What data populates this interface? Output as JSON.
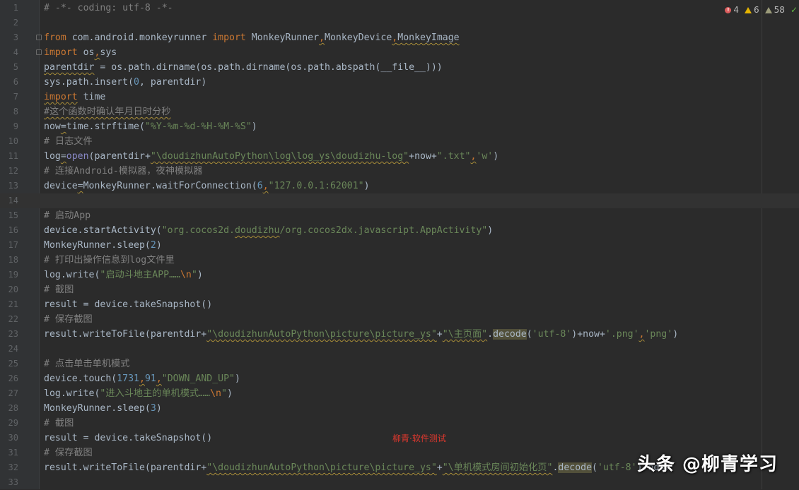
{
  "editor": {
    "current_line": 14,
    "lines": [
      {
        "n": "1",
        "fold": false,
        "tokens": [
          {
            "t": "# -*- coding: utf-8 -*-",
            "c": "comment"
          }
        ]
      },
      {
        "n": "2",
        "fold": false,
        "tokens": []
      },
      {
        "n": "3",
        "fold": true,
        "tokens": [
          {
            "t": "from",
            "c": "keyword"
          },
          {
            "t": " com.android.monkeyrunner ",
            "c": "default"
          },
          {
            "t": "import",
            "c": "keyword"
          },
          {
            "t": " MonkeyRunner",
            "c": "default"
          },
          {
            "t": ",",
            "c": "keyword",
            "w": true
          },
          {
            "t": "MonkeyDevice",
            "c": "default"
          },
          {
            "t": ",",
            "c": "keyword",
            "w": true
          },
          {
            "t": "MonkeyImage",
            "c": "default",
            "w": true
          }
        ]
      },
      {
        "n": "4",
        "fold": true,
        "tokens": [
          {
            "t": "import",
            "c": "keyword"
          },
          {
            "t": " os",
            "c": "default"
          },
          {
            "t": ",",
            "c": "keyword",
            "w": true
          },
          {
            "t": "sys",
            "c": "default"
          }
        ]
      },
      {
        "n": "5",
        "fold": false,
        "tokens": [
          {
            "t": "parentdir",
            "c": "default",
            "w": true
          },
          {
            "t": " = os.path.dirname(os.path.dirname(os.path.abspath(__file__)))",
            "c": "default"
          }
        ]
      },
      {
        "n": "6",
        "fold": false,
        "tokens": [
          {
            "t": "sys.path.insert(",
            "c": "default"
          },
          {
            "t": "0",
            "c": "number"
          },
          {
            "t": ", parentdir)",
            "c": "default"
          }
        ]
      },
      {
        "n": "7",
        "fold": false,
        "tokens": [
          {
            "t": "import",
            "c": "keyword",
            "w": true
          },
          {
            "t": " time",
            "c": "default"
          }
        ]
      },
      {
        "n": "8",
        "fold": false,
        "tokens": [
          {
            "t": "#这个函数时确认年月日时分秒",
            "c": "comment",
            "w": true
          }
        ]
      },
      {
        "n": "9",
        "fold": false,
        "tokens": [
          {
            "t": "now",
            "c": "default"
          },
          {
            "t": "=",
            "c": "default",
            "w": true
          },
          {
            "t": "time.strftime(",
            "c": "default"
          },
          {
            "t": "\"%Y-%m-%d-%H-%M-%S\"",
            "c": "string"
          },
          {
            "t": ")",
            "c": "default"
          }
        ]
      },
      {
        "n": "10",
        "fold": false,
        "tokens": [
          {
            "t": "# 日志文件",
            "c": "comment"
          }
        ]
      },
      {
        "n": "11",
        "fold": false,
        "tokens": [
          {
            "t": "log",
            "c": "default"
          },
          {
            "t": "=",
            "c": "default",
            "w": true
          },
          {
            "t": "open",
            "c": "builtin"
          },
          {
            "t": "(parentdir+",
            "c": "default"
          },
          {
            "t": "\"\\doudizhunAutoPython\\log\\log_ys\\doudizhu-log\"",
            "c": "string",
            "w": true
          },
          {
            "t": "+now+",
            "c": "default"
          },
          {
            "t": "\".txt\"",
            "c": "string"
          },
          {
            "t": ",",
            "c": "keyword",
            "w": true
          },
          {
            "t": "'w'",
            "c": "string"
          },
          {
            "t": ")",
            "c": "default"
          }
        ]
      },
      {
        "n": "12",
        "fold": false,
        "tokens": [
          {
            "t": "# 连接Android-模拟器，夜神模拟器",
            "c": "comment"
          }
        ]
      },
      {
        "n": "13",
        "fold": false,
        "tokens": [
          {
            "t": "device",
            "c": "default"
          },
          {
            "t": "=",
            "c": "default",
            "w": true
          },
          {
            "t": "MonkeyRunner.waitForConnection(",
            "c": "default"
          },
          {
            "t": "6",
            "c": "number"
          },
          {
            "t": ",",
            "c": "keyword",
            "w": true
          },
          {
            "t": "\"127.0.0.1:62001\"",
            "c": "string"
          },
          {
            "t": ")",
            "c": "default"
          }
        ]
      },
      {
        "n": "14",
        "fold": false,
        "tokens": []
      },
      {
        "n": "15",
        "fold": false,
        "tokens": [
          {
            "t": "# 启动App",
            "c": "comment"
          }
        ]
      },
      {
        "n": "16",
        "fold": false,
        "tokens": [
          {
            "t": "device.startActivity(",
            "c": "default"
          },
          {
            "t": "\"org.cocos2d.",
            "c": "string"
          },
          {
            "t": "doudizhu",
            "c": "string",
            "w": true
          },
          {
            "t": "/org.cocos2dx.javascript.AppActivity\"",
            "c": "string"
          },
          {
            "t": ")",
            "c": "default"
          }
        ]
      },
      {
        "n": "17",
        "fold": false,
        "tokens": [
          {
            "t": "MonkeyRunner.sleep(",
            "c": "default"
          },
          {
            "t": "2",
            "c": "number"
          },
          {
            "t": ")",
            "c": "default"
          }
        ]
      },
      {
        "n": "18",
        "fold": false,
        "tokens": [
          {
            "t": "# 打印出操作信息到log文件里",
            "c": "comment"
          }
        ]
      },
      {
        "n": "19",
        "fold": false,
        "tokens": [
          {
            "t": "log.write(",
            "c": "default"
          },
          {
            "t": "\"启动斗地主APP……",
            "c": "string"
          },
          {
            "t": "\\n",
            "c": "escape"
          },
          {
            "t": "\"",
            "c": "string"
          },
          {
            "t": ")",
            "c": "default"
          }
        ]
      },
      {
        "n": "20",
        "fold": false,
        "tokens": [
          {
            "t": "# 截图",
            "c": "comment"
          }
        ]
      },
      {
        "n": "21",
        "fold": false,
        "tokens": [
          {
            "t": "result = device.takeSnapshot()",
            "c": "default"
          }
        ]
      },
      {
        "n": "22",
        "fold": false,
        "tokens": [
          {
            "t": "# 保存截图",
            "c": "comment"
          }
        ]
      },
      {
        "n": "23",
        "fold": false,
        "tokens": [
          {
            "t": "result.writeToFile(parentdir+",
            "c": "default"
          },
          {
            "t": "\"\\doudizhunAutoPython\\picture\\picture_ys\"",
            "c": "string",
            "w": true
          },
          {
            "t": "+",
            "c": "default"
          },
          {
            "t": "\"\\主页面\"",
            "c": "string",
            "w": true
          },
          {
            "t": ".",
            "c": "default"
          },
          {
            "t": "decode",
            "c": "hl"
          },
          {
            "t": "(",
            "c": "default"
          },
          {
            "t": "'utf-8'",
            "c": "string"
          },
          {
            "t": ")+now+",
            "c": "default"
          },
          {
            "t": "'.png'",
            "c": "string"
          },
          {
            "t": ",",
            "c": "keyword",
            "w": true
          },
          {
            "t": "'png'",
            "c": "string"
          },
          {
            "t": ")",
            "c": "default"
          }
        ]
      },
      {
        "n": "24",
        "fold": false,
        "tokens": []
      },
      {
        "n": "25",
        "fold": false,
        "tokens": [
          {
            "t": "# 点击单击单机模式",
            "c": "comment"
          }
        ]
      },
      {
        "n": "26",
        "fold": false,
        "tokens": [
          {
            "t": "device.touch(",
            "c": "default"
          },
          {
            "t": "1731",
            "c": "number"
          },
          {
            "t": ",",
            "c": "keyword",
            "w": true
          },
          {
            "t": "91",
            "c": "number"
          },
          {
            "t": ",",
            "c": "keyword",
            "w": true
          },
          {
            "t": "\"DOWN_AND_UP\"",
            "c": "string"
          },
          {
            "t": ")",
            "c": "default"
          }
        ]
      },
      {
        "n": "27",
        "fold": false,
        "tokens": [
          {
            "t": "log.write(",
            "c": "default"
          },
          {
            "t": "\"进入斗地主的单机模式……",
            "c": "string"
          },
          {
            "t": "\\n",
            "c": "escape"
          },
          {
            "t": "\"",
            "c": "string"
          },
          {
            "t": ")",
            "c": "default"
          }
        ]
      },
      {
        "n": "28",
        "fold": false,
        "tokens": [
          {
            "t": "MonkeyRunner.sleep(",
            "c": "default"
          },
          {
            "t": "3",
            "c": "number"
          },
          {
            "t": ")",
            "c": "default"
          }
        ]
      },
      {
        "n": "29",
        "fold": false,
        "tokens": [
          {
            "t": "# 截图",
            "c": "comment"
          }
        ]
      },
      {
        "n": "30",
        "fold": false,
        "tokens": [
          {
            "t": "result = device.takeSnapshot()",
            "c": "default"
          }
        ]
      },
      {
        "n": "31",
        "fold": false,
        "tokens": [
          {
            "t": "# 保存截图",
            "c": "comment"
          }
        ]
      },
      {
        "n": "32",
        "fold": false,
        "tokens": [
          {
            "t": "result.writeToFile(parentdir+",
            "c": "default"
          },
          {
            "t": "\"\\doudizhunAutoPython\\picture\\picture_ys\"",
            "c": "string",
            "w": true
          },
          {
            "t": "+",
            "c": "default"
          },
          {
            "t": "\"\\单机模式房间初始化页\"",
            "c": "string",
            "w": true
          },
          {
            "t": ".",
            "c": "default"
          },
          {
            "t": "decode",
            "c": "hl"
          },
          {
            "t": "(",
            "c": "default"
          },
          {
            "t": "'utf-8'",
            "c": "string"
          },
          {
            "t": ")+now+",
            "c": "default"
          }
        ]
      },
      {
        "n": "33",
        "fold": false,
        "tokens": []
      }
    ]
  },
  "inspection": {
    "errors": "4",
    "warnings": "6",
    "weak_warnings": "58",
    "icons": [
      "error-icon",
      "warning-icon",
      "weak-warning-icon",
      "check-icon"
    ]
  },
  "watermarks": {
    "red_text": "柳青·软件测试",
    "brand_text": "头条 @柳青学习"
  },
  "colors": {
    "background": "#2b2b2b",
    "keyword": "#cc7832",
    "string": "#6a8759",
    "comment": "#808080",
    "number": "#6897bb"
  }
}
